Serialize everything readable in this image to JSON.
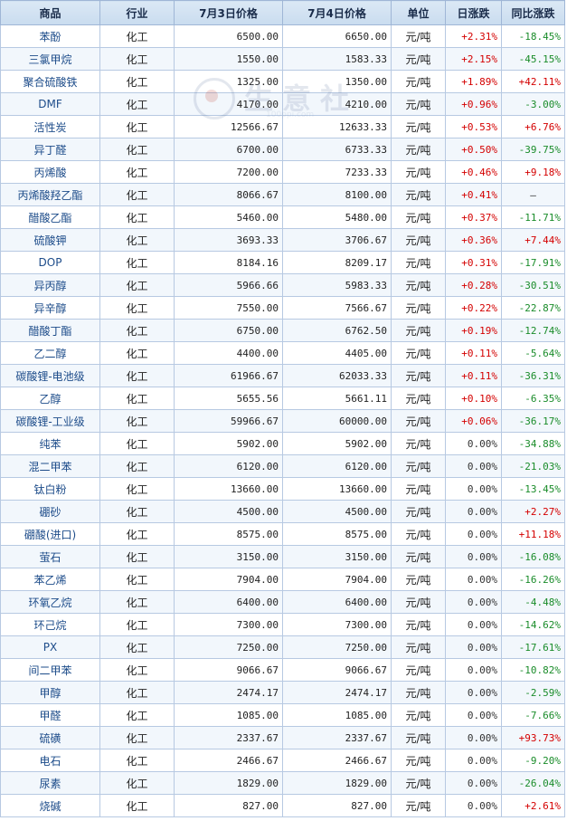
{
  "headers": [
    "商品",
    "行业",
    "7月3日价格",
    "7月4日价格",
    "单位",
    "日涨跌",
    "同比涨跌"
  ],
  "watermark": {
    "text": "生意社",
    "url": "100ppi.com"
  },
  "colors": {
    "up": "#d40000",
    "down": "#1a8c2a",
    "header_bg": "#c9dcef",
    "link": "#1d4c8a"
  },
  "rows": [
    {
      "name": "苯酚",
      "industry": "化工",
      "p1": "6500.00",
      "p2": "6650.00",
      "unit": "元/吨",
      "day": "+2.31%",
      "yoy": "-18.45%"
    },
    {
      "name": "三氯甲烷",
      "industry": "化工",
      "p1": "1550.00",
      "p2": "1583.33",
      "unit": "元/吨",
      "day": "+2.15%",
      "yoy": "-45.15%"
    },
    {
      "name": "聚合硫酸铁",
      "industry": "化工",
      "p1": "1325.00",
      "p2": "1350.00",
      "unit": "元/吨",
      "day": "+1.89%",
      "yoy": "+42.11%"
    },
    {
      "name": "DMF",
      "industry": "化工",
      "p1": "4170.00",
      "p2": "4210.00",
      "unit": "元/吨",
      "day": "+0.96%",
      "yoy": "-3.00%"
    },
    {
      "name": "活性炭",
      "industry": "化工",
      "p1": "12566.67",
      "p2": "12633.33",
      "unit": "元/吨",
      "day": "+0.53%",
      "yoy": "+6.76%"
    },
    {
      "name": "异丁醛",
      "industry": "化工",
      "p1": "6700.00",
      "p2": "6733.33",
      "unit": "元/吨",
      "day": "+0.50%",
      "yoy": "-39.75%"
    },
    {
      "name": "丙烯酸",
      "industry": "化工",
      "p1": "7200.00",
      "p2": "7233.33",
      "unit": "元/吨",
      "day": "+0.46%",
      "yoy": "+9.18%"
    },
    {
      "name": "丙烯酸羟乙酯",
      "industry": "化工",
      "p1": "8066.67",
      "p2": "8100.00",
      "unit": "元/吨",
      "day": "+0.41%",
      "yoy": "—"
    },
    {
      "name": "醋酸乙酯",
      "industry": "化工",
      "p1": "5460.00",
      "p2": "5480.00",
      "unit": "元/吨",
      "day": "+0.37%",
      "yoy": "-11.71%"
    },
    {
      "name": "硫酸钾",
      "industry": "化工",
      "p1": "3693.33",
      "p2": "3706.67",
      "unit": "元/吨",
      "day": "+0.36%",
      "yoy": "+7.44%"
    },
    {
      "name": "DOP",
      "industry": "化工",
      "p1": "8184.16",
      "p2": "8209.17",
      "unit": "元/吨",
      "day": "+0.31%",
      "yoy": "-17.91%"
    },
    {
      "name": "异丙醇",
      "industry": "化工",
      "p1": "5966.66",
      "p2": "5983.33",
      "unit": "元/吨",
      "day": "+0.28%",
      "yoy": "-30.51%"
    },
    {
      "name": "异辛醇",
      "industry": "化工",
      "p1": "7550.00",
      "p2": "7566.67",
      "unit": "元/吨",
      "day": "+0.22%",
      "yoy": "-22.87%"
    },
    {
      "name": "醋酸丁酯",
      "industry": "化工",
      "p1": "6750.00",
      "p2": "6762.50",
      "unit": "元/吨",
      "day": "+0.19%",
      "yoy": "-12.74%"
    },
    {
      "name": "乙二醇",
      "industry": "化工",
      "p1": "4400.00",
      "p2": "4405.00",
      "unit": "元/吨",
      "day": "+0.11%",
      "yoy": "-5.64%"
    },
    {
      "name": "碳酸锂-电池级",
      "industry": "化工",
      "p1": "61966.67",
      "p2": "62033.33",
      "unit": "元/吨",
      "day": "+0.11%",
      "yoy": "-36.31%"
    },
    {
      "name": "乙醇",
      "industry": "化工",
      "p1": "5655.56",
      "p2": "5661.11",
      "unit": "元/吨",
      "day": "+0.10%",
      "yoy": "-6.35%"
    },
    {
      "name": "碳酸锂-工业级",
      "industry": "化工",
      "p1": "59966.67",
      "p2": "60000.00",
      "unit": "元/吨",
      "day": "+0.06%",
      "yoy": "-36.17%"
    },
    {
      "name": "纯苯",
      "industry": "化工",
      "p1": "5902.00",
      "p2": "5902.00",
      "unit": "元/吨",
      "day": "0.00%",
      "yoy": "-34.88%"
    },
    {
      "name": "混二甲苯",
      "industry": "化工",
      "p1": "6120.00",
      "p2": "6120.00",
      "unit": "元/吨",
      "day": "0.00%",
      "yoy": "-21.03%"
    },
    {
      "name": "钛白粉",
      "industry": "化工",
      "p1": "13660.00",
      "p2": "13660.00",
      "unit": "元/吨",
      "day": "0.00%",
      "yoy": "-13.45%"
    },
    {
      "name": "硼砂",
      "industry": "化工",
      "p1": "4500.00",
      "p2": "4500.00",
      "unit": "元/吨",
      "day": "0.00%",
      "yoy": "+2.27%"
    },
    {
      "name": "硼酸(进口)",
      "industry": "化工",
      "p1": "8575.00",
      "p2": "8575.00",
      "unit": "元/吨",
      "day": "0.00%",
      "yoy": "+11.18%"
    },
    {
      "name": "萤石",
      "industry": "化工",
      "p1": "3150.00",
      "p2": "3150.00",
      "unit": "元/吨",
      "day": "0.00%",
      "yoy": "-16.08%"
    },
    {
      "name": "苯乙烯",
      "industry": "化工",
      "p1": "7904.00",
      "p2": "7904.00",
      "unit": "元/吨",
      "day": "0.00%",
      "yoy": "-16.26%"
    },
    {
      "name": "环氧乙烷",
      "industry": "化工",
      "p1": "6400.00",
      "p2": "6400.00",
      "unit": "元/吨",
      "day": "0.00%",
      "yoy": "-4.48%"
    },
    {
      "name": "环己烷",
      "industry": "化工",
      "p1": "7300.00",
      "p2": "7300.00",
      "unit": "元/吨",
      "day": "0.00%",
      "yoy": "-14.62%"
    },
    {
      "name": "PX",
      "industry": "化工",
      "p1": "7250.00",
      "p2": "7250.00",
      "unit": "元/吨",
      "day": "0.00%",
      "yoy": "-17.61%"
    },
    {
      "name": "间二甲苯",
      "industry": "化工",
      "p1": "9066.67",
      "p2": "9066.67",
      "unit": "元/吨",
      "day": "0.00%",
      "yoy": "-10.82%"
    },
    {
      "name": "甲醇",
      "industry": "化工",
      "p1": "2474.17",
      "p2": "2474.17",
      "unit": "元/吨",
      "day": "0.00%",
      "yoy": "-2.59%"
    },
    {
      "name": "甲醛",
      "industry": "化工",
      "p1": "1085.00",
      "p2": "1085.00",
      "unit": "元/吨",
      "day": "0.00%",
      "yoy": "-7.66%"
    },
    {
      "name": "硫磺",
      "industry": "化工",
      "p1": "2337.67",
      "p2": "2337.67",
      "unit": "元/吨",
      "day": "0.00%",
      "yoy": "+93.73%"
    },
    {
      "name": "电石",
      "industry": "化工",
      "p1": "2466.67",
      "p2": "2466.67",
      "unit": "元/吨",
      "day": "0.00%",
      "yoy": "-9.20%"
    },
    {
      "name": "尿素",
      "industry": "化工",
      "p1": "1829.00",
      "p2": "1829.00",
      "unit": "元/吨",
      "day": "0.00%",
      "yoy": "-26.04%"
    },
    {
      "name": "烧碱",
      "industry": "化工",
      "p1": "827.00",
      "p2": "827.00",
      "unit": "元/吨",
      "day": "0.00%",
      "yoy": "+2.61%"
    }
  ]
}
